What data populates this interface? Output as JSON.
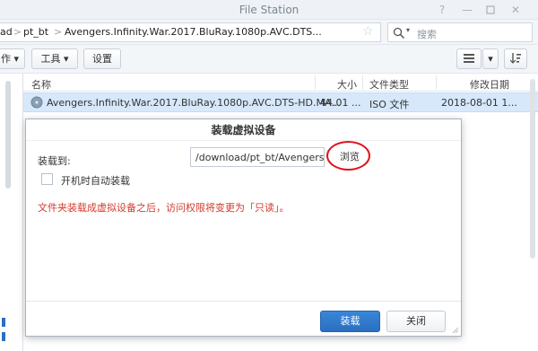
{
  "window": {
    "title": "File Station",
    "controls": [
      "help-icon",
      "minimize-icon",
      "maximize-icon",
      "close-icon"
    ]
  },
  "path": {
    "crumbs": [
      "ad",
      "pt_bt",
      "Avengers.Infinity.War.2017.BluRay.1080p.AVC.DTS..."
    ],
    "separator": ">",
    "star": "☆"
  },
  "search": {
    "placeholder": "搜索"
  },
  "toolbar": {
    "action_label": "作 ▾",
    "tools_label": "工具 ▾",
    "settings_label": "设置"
  },
  "grid": {
    "columns": [
      "名称",
      "大小",
      "文件类型",
      "修改日期"
    ],
    "rows": [
      {
        "name": "Avengers.Infinity.War.2017.BluRay.1080p.AVC.DTS-HD.MA...",
        "size": "44.01 ...",
        "type": "ISO 文件",
        "modified": "2018-08-01 1..."
      }
    ]
  },
  "dialog": {
    "title": "装载虚拟设备",
    "mount_to_label": "装载到:",
    "mount_path": "/download/pt_bt/Avengers.In",
    "browse_label": "浏览",
    "auto_mount_label": "开机时自动装载",
    "auto_mount_checked": false,
    "note": "文件夹装载成虚拟设备之后，访问权限将变更为「只读」。",
    "mount_button": "装载",
    "close_button": "关闭"
  },
  "colors": {
    "accent": "#2a6fc0",
    "selected_row": "#d6e8fa",
    "note_red": "#d33a2c",
    "annotation_red": "#e0141e"
  }
}
